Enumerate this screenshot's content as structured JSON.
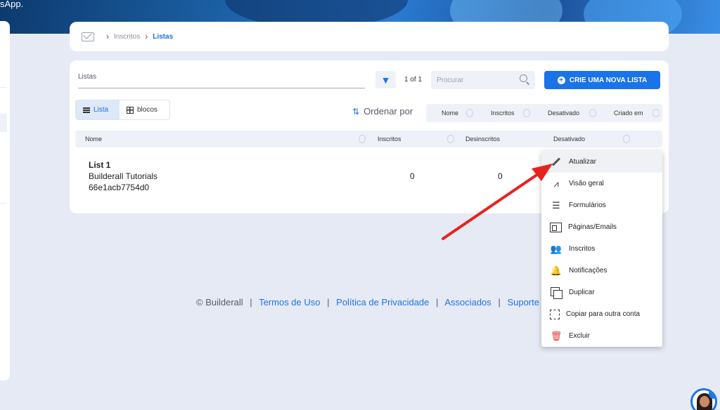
{
  "banner": {
    "text": "sApp."
  },
  "breadcrumb": {
    "items": [
      "Inscritos",
      "Listas"
    ]
  },
  "toolbar": {
    "list_name_label": "Listas",
    "page_count": "1 of 1",
    "search_placeholder": "Procurar",
    "create_button": "CRIE UMA NOVA LISTA"
  },
  "view_toggle": {
    "list": "Lista",
    "blocks": "blocos"
  },
  "sort": {
    "label": "Ordenar por",
    "options": [
      "Nome",
      "Inscritos",
      "Desativado",
      "Criado em"
    ]
  },
  "table": {
    "columns": [
      "Nome",
      "Inscritos",
      "Desinscritos",
      "Desativado"
    ],
    "rows": [
      {
        "name": "List 1",
        "owner": "Builderall Tutorials",
        "id": "66e1acb7754d0",
        "inscritos": "0",
        "desinscritos": "0"
      }
    ]
  },
  "context_menu": {
    "items": [
      "Atualizar",
      "Visão geral",
      "Formulários",
      "Páginas/Emails",
      "Inscritos",
      "Notificações",
      "Duplicar",
      "Copiar para outra conta",
      "Excluir"
    ]
  },
  "footer": {
    "copyright": "© Builderall",
    "links": [
      "Termos de Uso",
      "Política de Privacidade",
      "Associados",
      "Suporte"
    ]
  },
  "help": {
    "badge": "?"
  },
  "colors": {
    "accent": "#1a73e8",
    "danger": "#e53935",
    "annotation_arrow": "#e8221c"
  }
}
